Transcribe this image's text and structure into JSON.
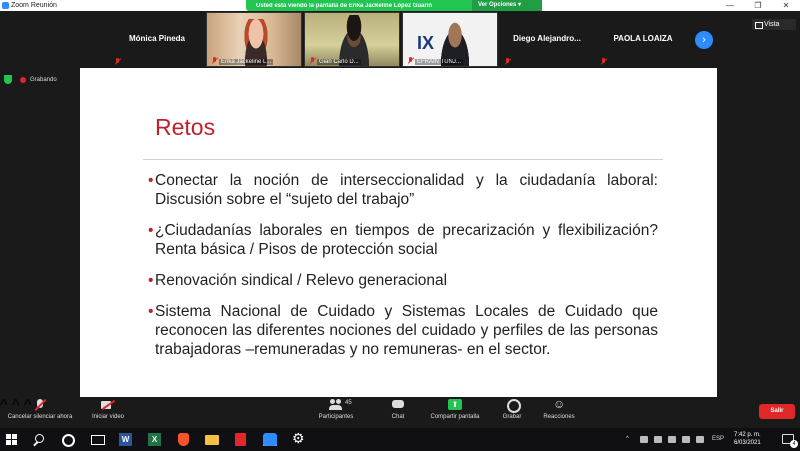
{
  "window": {
    "title": "Zoom Reunión",
    "minimize_glyph": "—",
    "maximize_glyph": "❐",
    "close_glyph": "✕"
  },
  "share_banner": {
    "text": "Usted está viendo la pantalla de Erika Jackeline López Guarín",
    "view_options": "Ver Opciones ▾",
    "color": "#23c552"
  },
  "participants": [
    {
      "name": "Mónica Pineda",
      "type": "name-only",
      "muted": true
    },
    {
      "name": "Erika Jackeline L...",
      "type": "video",
      "muted": true
    },
    {
      "name": "Gian Carlo D...",
      "type": "video",
      "muted": true
    },
    {
      "name": "EFRAÍN TUNJ...",
      "type": "video",
      "muted": true
    },
    {
      "name": "Diego Alejandro...",
      "type": "name-only",
      "muted": true
    },
    {
      "name": "PAOLA LOAIZA",
      "type": "name-only",
      "muted": true
    }
  ],
  "view_button": "Vista",
  "recording": {
    "label": "Grabando"
  },
  "slide": {
    "title": "Retos",
    "bullets": [
      "Conectar la noción de interseccionalidad y la ciudadanía laboral: Discusión sobre el “sujeto del trabajo”",
      "¿Ciudadanías laborales en tiempos de precarización y flexibilización? Renta básica / Pisos de protección social",
      "Renovación sindical / Relevo generacional",
      "Sistema Nacional de Cuidado y Sistemas Locales de Cuidado que reconocen las diferentes nociones del cuidado y perfiles de las personas trabajadoras –remuneradas y no remuneras- en el sector."
    ],
    "bullet_glyph": "•",
    "accent": "#c0202a"
  },
  "toolbar": {
    "unmute": "Cancelar silenciar ahora",
    "video": "Iniciar video",
    "participants": "Participantes",
    "participants_count": "45",
    "chat": "Chat",
    "share": "Compartir pantalla",
    "record": "Grabar",
    "reactions": "Reacciones",
    "leave": "Salir",
    "caret": "^"
  },
  "taskbar": {
    "tray_chevron": "^",
    "language": "ESP",
    "time": "7:42 p. m.",
    "date": "6/03/2021",
    "notifications": "4"
  }
}
